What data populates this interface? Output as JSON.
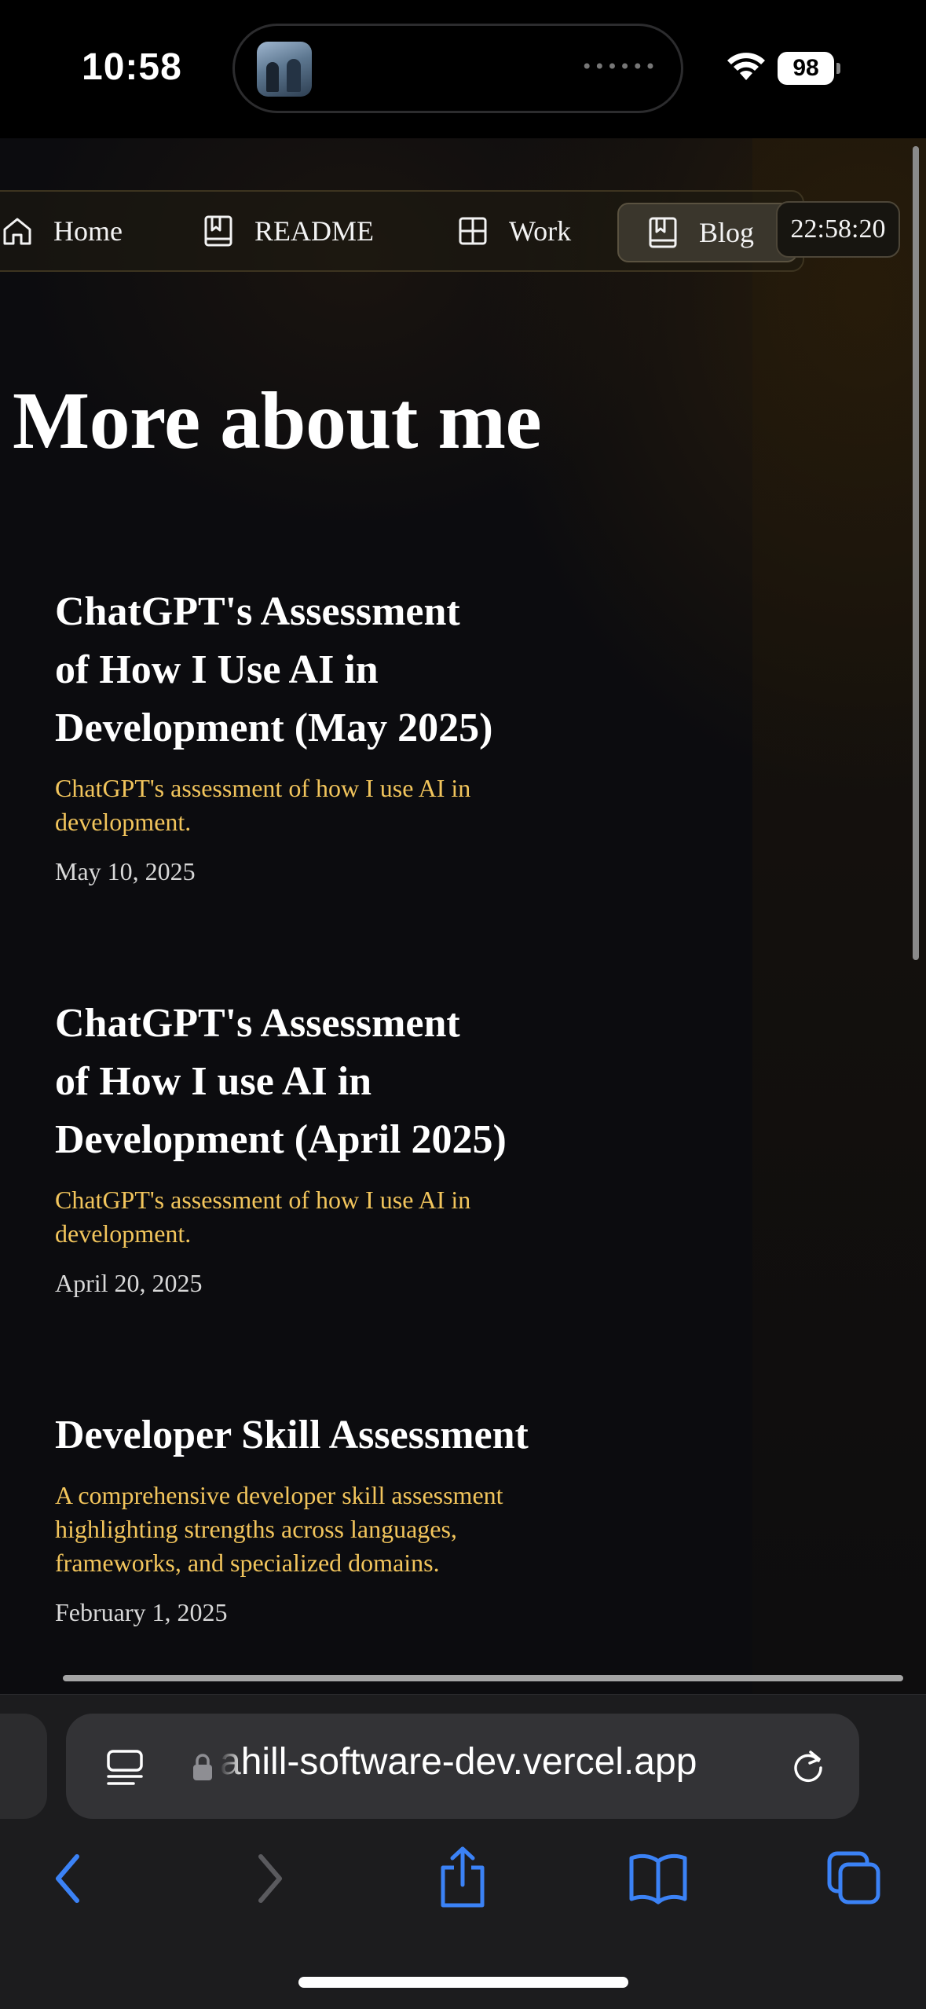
{
  "status_bar": {
    "time": "10:58",
    "battery": "98"
  },
  "nav": {
    "items": [
      {
        "label": "Home"
      },
      {
        "label": "README"
      },
      {
        "label": "Work"
      },
      {
        "label": "Blog"
      }
    ],
    "clock": "22:58:20"
  },
  "page": {
    "title": "More about me"
  },
  "posts": [
    {
      "title_lines": [
        "ChatGPT's Assessment",
        "of How I Use AI in",
        "Development (May 2025)"
      ],
      "desc_lines": [
        "ChatGPT's assessment of how I use AI in",
        "development."
      ],
      "date": "May 10, 2025"
    },
    {
      "title_lines": [
        "ChatGPT's Assessment",
        "of How I use AI in",
        "Development (April 2025)"
      ],
      "desc_lines": [
        "ChatGPT's assessment of how I use AI in",
        "development."
      ],
      "date": "April 20, 2025"
    },
    {
      "title_lines": [
        "Developer Skill Assessment"
      ],
      "desc_lines": [
        "A comprehensive developer skill assessment",
        "highlighting strengths across languages,",
        "frameworks, and specialized domains."
      ],
      "date": "February 1, 2025"
    }
  ],
  "browser": {
    "url": "ahill-software-dev.vercel.app"
  },
  "colors": {
    "accent": "#f2c55c",
    "background": "#0c0c0f",
    "browser_blue": "#3b82f6"
  }
}
